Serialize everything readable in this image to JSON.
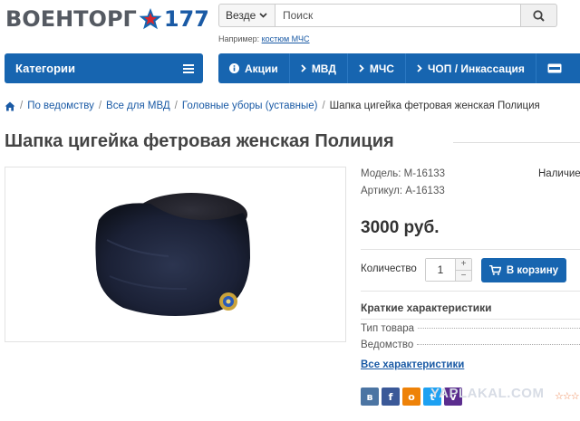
{
  "logo": {
    "left": "ВОЕНТОРГ",
    "right": "177"
  },
  "search": {
    "scope": "Везде",
    "placeholder": "Поиск",
    "hint_prefix": "Например:",
    "hint_link": "костюм МЧС"
  },
  "nav": {
    "categories": "Категории",
    "menu": [
      {
        "label": "Акции",
        "icon": "info-icon"
      },
      {
        "label": "МВД",
        "icon": "chevron-right-icon"
      },
      {
        "label": "МЧС",
        "icon": "chevron-right-icon"
      },
      {
        "label": "ЧОП / Инкассация",
        "icon": "chevron-right-icon"
      },
      {
        "label": "",
        "icon": "visa-card-icon"
      }
    ]
  },
  "breadcrumb": [
    "По ведомству",
    "Все для МВД",
    "Головные уборы (уставные)",
    "Шапка цигейка фетровая женская Полиция"
  ],
  "product": {
    "title": "Шапка цигейка фетровая женская Полиция",
    "model": "Модель: М-16133",
    "article": "Артикул: А-16133",
    "availability": "Наличие",
    "price": "3000 руб.",
    "qty_label": "Количество",
    "qty_value": "1",
    "cart_label": "В корзину"
  },
  "characteristics": {
    "title": "Краткие характеристики",
    "rows": [
      "Тип товара",
      "Ведомство"
    ],
    "all_link": "Все характеристики"
  },
  "watermark": "YAPLAKAL.COM",
  "colors": {
    "brand_blue": "#1765b0",
    "logo_gray": "#555a62",
    "link": "#1a5aa5"
  }
}
